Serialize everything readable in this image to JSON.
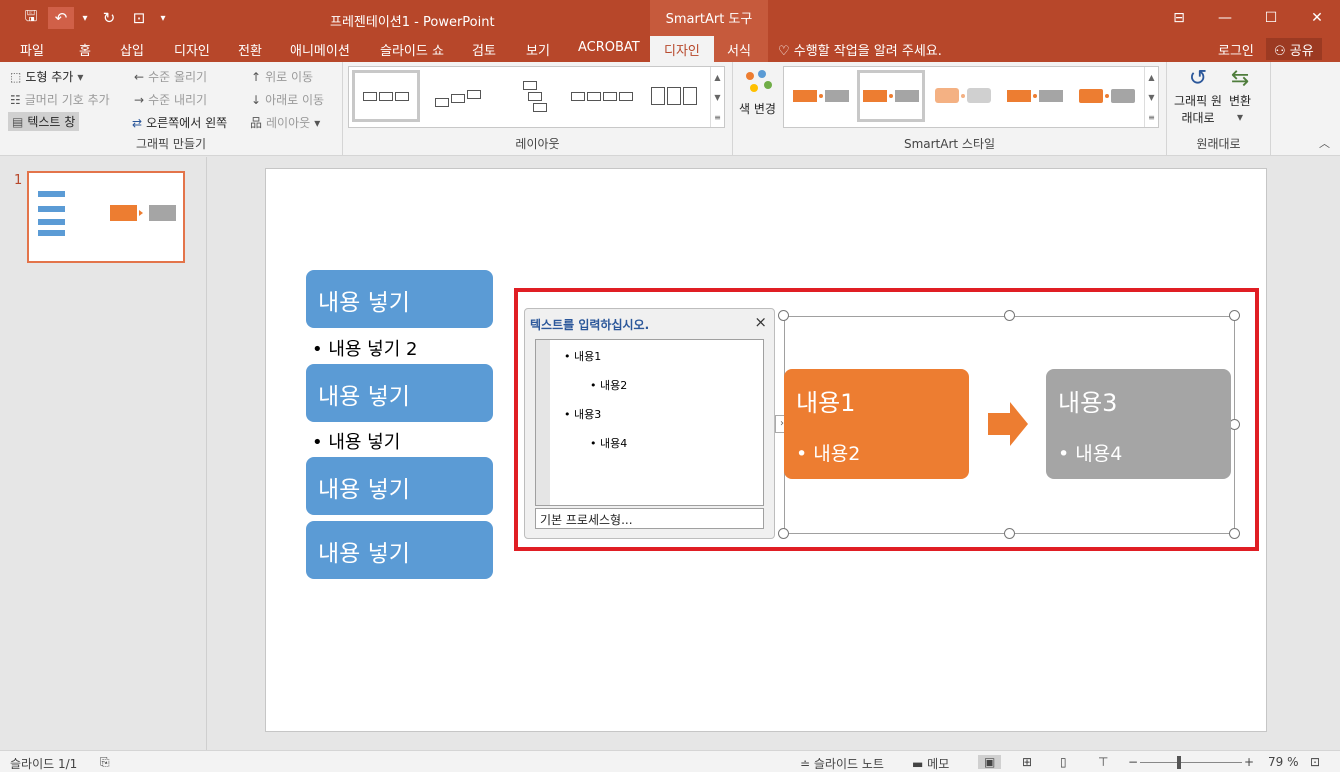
{
  "window": {
    "title": "프레젠테이션1 - PowerPoint",
    "context_tool": "SmartArt 도구",
    "accent": "#b7472a"
  },
  "qat": {
    "save_icon": "save-icon",
    "undo_icon": "undo-icon",
    "redo_icon": "redo-icon",
    "present_icon": "present-icon"
  },
  "tabs": {
    "file": "파일",
    "home": "홈",
    "insert": "삽입",
    "design": "디자인",
    "transitions": "전환",
    "animations": "애니메이션",
    "slideshow": "슬라이드 쇼",
    "review": "검토",
    "view": "보기",
    "acrobat": "ACROBAT",
    "sa_design": "디자인",
    "sa_format": "서식",
    "tell_me": "수행할 작업을 알려 주세요.",
    "login": "로그인",
    "share": "공유"
  },
  "ribbon": {
    "create_graphic": {
      "label": "그래픽 만들기",
      "add_shape": "도형 추가",
      "add_bullet": "글머리 기호 추가",
      "text_pane": "텍스트 창",
      "promote": "수준 올리기",
      "demote": "수준 내리기",
      "right_to_left": "오른쪽에서 왼쪽",
      "move_up": "위로 이동",
      "move_down": "아래로 이동",
      "layout": "레이아웃"
    },
    "layouts": {
      "label": "레이아웃"
    },
    "styles": {
      "label": "SmartArt 스타일",
      "change_colors": "색 변경"
    },
    "reset": {
      "label": "원래대로",
      "reset_graphic": "그래픽 원래대로",
      "convert": "변환"
    }
  },
  "thumbnail": {
    "number": "1"
  },
  "slide": {
    "left_list": {
      "box1": "내용 넣기",
      "bullet1": "• 내용 넣기 2",
      "box2": "내용 넣기",
      "bullet2": "• 내용 넣기",
      "box3": "내용 넣기",
      "box4": "내용 넣기"
    },
    "text_pane": {
      "title": "텍스트를 입력하십시오.",
      "close": "×",
      "items": [
        "내용1",
        "내용2",
        "내용3",
        "내용4"
      ],
      "footer": "기본 프로세스형..."
    },
    "smartart": {
      "box1_title": "내용1",
      "box1_bullet": "• 내용2",
      "box2_title": "내용3",
      "box2_bullet": "• 내용4",
      "orange": "#ed7d31",
      "gray": "#a5a5a5",
      "blue": "#5b9bd5"
    }
  },
  "status": {
    "slide_info": "슬라이드 1/1",
    "notes": "슬라이드 노트",
    "comments": "메모",
    "zoom": "79 %"
  }
}
